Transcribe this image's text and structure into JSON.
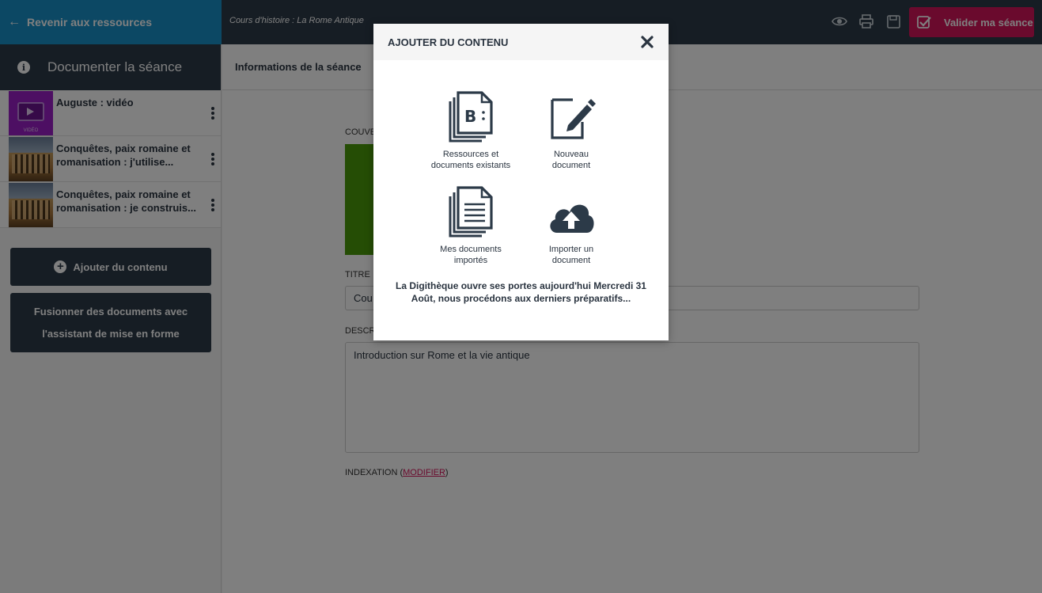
{
  "topbar": {
    "back_label": "Revenir aux ressources",
    "course_title": "Cours d'histoire : La Rome Antique",
    "validate_label": "Valider ma séance",
    "icons": [
      "eye-icon",
      "print-icon",
      "save-icon"
    ]
  },
  "sidebar": {
    "header": "Documenter la séance",
    "items": [
      {
        "title": "Auguste : vidéo",
        "thumb": "video",
        "thumb_label": "VIDÉO"
      },
      {
        "title": "Conquêtes, paix romaine et romanisation : j'utilise...",
        "thumb": "colosseum"
      },
      {
        "title": "Conquêtes, paix romaine et romanisation : je construis...",
        "thumb": "colosseum"
      }
    ],
    "add_label": "Ajouter du contenu",
    "merge_label": "Fusionner des documents avec l'assistant de mise en forme"
  },
  "main": {
    "tab_label": "Informations de la séance",
    "cover_label": "COUVE",
    "title_label": "TITRE",
    "title_value": "Cou",
    "desc_label": "DESCR",
    "desc_value": "Introduction sur Rome et la vie antique",
    "indexation_label": "INDEXATION (",
    "indexation_link": "MODIFIER",
    "indexation_close": ")"
  },
  "modal": {
    "title": "AJOUTER DU CONTENU",
    "tiles": [
      {
        "label": "Ressources et documents existants",
        "icon": "existing-resources-icon"
      },
      {
        "label": "Nouveau document",
        "icon": "new-document-icon"
      },
      {
        "label": "Mes documents importés",
        "icon": "imported-documents-icon"
      },
      {
        "label": "Importer un document",
        "icon": "cloud-upload-icon"
      }
    ],
    "notice": "La Digithèque ouvre ses portes aujourd'hui Mercredi 31 Août, nous procédons aux derniers préparatifs..."
  },
  "colors": {
    "topbar": "#2c3a48",
    "back": "#1891c9",
    "accent": "#d4145a"
  }
}
